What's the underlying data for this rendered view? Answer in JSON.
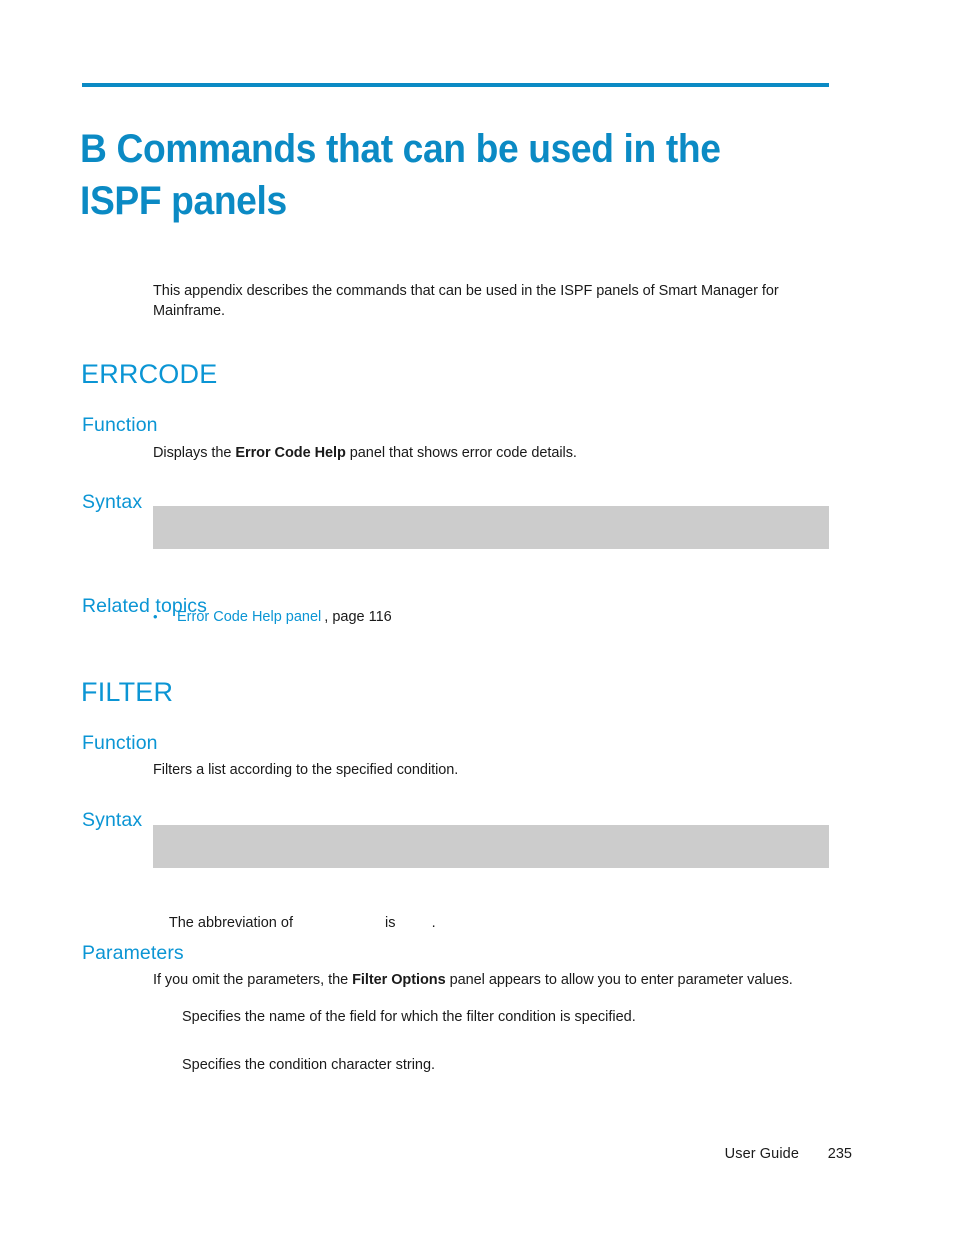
{
  "document": {
    "accent_color": "#0b95d4",
    "rule_color": "#0b8ac4",
    "syntax_box_color": "#cccccc",
    "body_text_color": "#1a1a1a"
  },
  "chapter": {
    "title": "B Commands that can be used in the ISPF panels",
    "intro": "This appendix describes the commands that can be used in the ISPF panels of Smart Manager for Mainframe."
  },
  "sections": [
    {
      "id": "errcode",
      "heading": "ERRCODE",
      "function": {
        "heading": "Function",
        "text_before_bold": "Displays the ",
        "bold_term": "Error Code Help",
        "text_after_bold": " panel that shows error code details."
      },
      "syntax": {
        "heading": "Syntax",
        "code": ""
      },
      "related_topics": {
        "heading": "Related topics",
        "items": [
          {
            "bullet": "•",
            "link_text": "Error Code Help panel",
            "page_reference": ", page 116"
          }
        ]
      }
    },
    {
      "id": "filter",
      "heading": "FILTER",
      "function": {
        "heading": "Function",
        "text": "Filters a list according to the specified condition."
      },
      "syntax": {
        "heading": "Syntax",
        "code": "",
        "abbreviation_note": {
          "prefix": "The abbreviation of ",
          "command": "",
          "middle": " is ",
          "abbreviation": "",
          "suffix": "."
        }
      },
      "parameters": {
        "heading": "Parameters",
        "intro_before_bold": "If you omit the parameters, the ",
        "intro_bold_term": "Filter Options",
        "intro_after_bold": " panel appears to allow you to enter parameter values.",
        "entries": [
          {
            "term": "",
            "description": "Specifies the name of the field for which the filter condition is specified."
          },
          {
            "term": "",
            "description": "Specifies the condition character string."
          }
        ]
      }
    }
  ],
  "footer": {
    "doc_title": "User Guide",
    "page_number": "235"
  }
}
